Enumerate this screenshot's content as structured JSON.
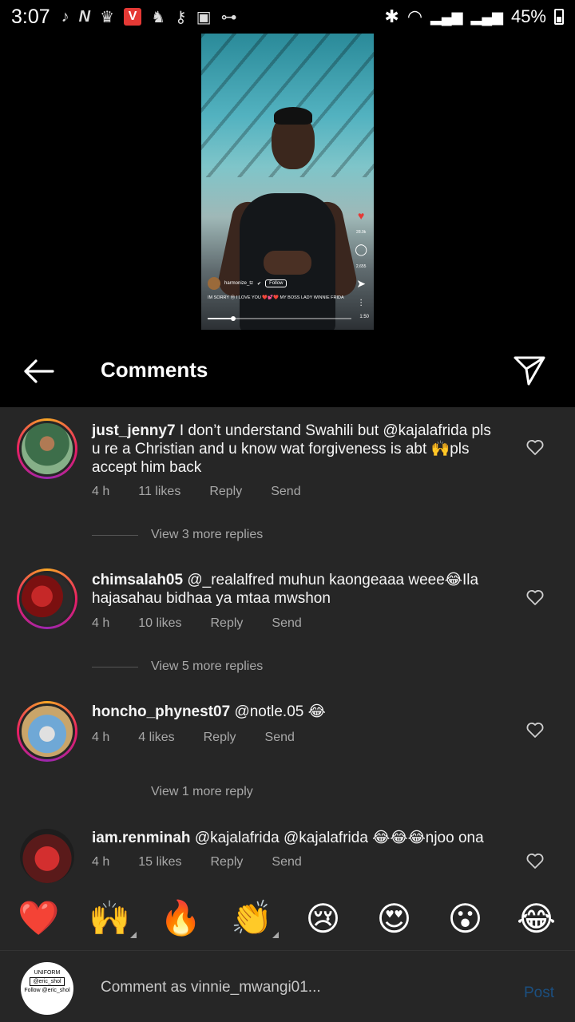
{
  "status_bar": {
    "time": "3:07",
    "battery": "45%"
  },
  "video": {
    "username": "harmonize_tz",
    "follow_label": "Follow",
    "caption": "IM SORRY 😔 I LOVE YOU ❤️💕❤️ MY BOSS LADY WINNIE FRIDA",
    "likes": "28.9k",
    "comments_count": "2,655",
    "duration": "1:50",
    "progress_percent": 18
  },
  "header": {
    "title": "Comments"
  },
  "comments": [
    {
      "username": "just_jenny7",
      "text_line1": "I don’t understand Swahili but @kajalafrida pls",
      "text_line2": "u re a Christian and u know wat forgiveness is abt 🙌pls",
      "text_line3": "accept him back",
      "time": "4 h",
      "likes": "11 likes",
      "reply": "Reply",
      "send": "Send",
      "view_replies": "View 3 more replies"
    },
    {
      "username": "chimsalah05",
      "text_line1": "@_realalfred muhun kaongeaaa weee😂Ila",
      "text_line2": "hajasahau bidhaa ya mtaa mwshon",
      "time": "4 h",
      "likes": "10 likes",
      "reply": "Reply",
      "send": "Send",
      "view_replies": "View 5 more replies"
    },
    {
      "username": "honcho_phynest07",
      "text_line1": "@notle.05 😂",
      "time": "4 h",
      "likes": "4 likes",
      "reply": "Reply",
      "send": "Send",
      "view_replies": "View 1 more reply"
    },
    {
      "username": "iam.renminah",
      "text_line1": "@kajalafrida @kajalafrida 😂😂😂njoo ona",
      "time": "4 h",
      "likes": "15 likes",
      "reply": "Reply",
      "send": "Send"
    }
  ],
  "emoji_bar": [
    "❤️",
    "🙌",
    "🔥",
    "👏",
    "😢",
    "😍",
    "😮",
    "😂"
  ],
  "composer": {
    "avatar_text_1": "UNIFORM",
    "avatar_text_2": "@eric_shol",
    "avatar_text_3": "Follow @eric_shol",
    "placeholder": "Comment as vinnie_mwangi01...",
    "post_label": "Post"
  }
}
